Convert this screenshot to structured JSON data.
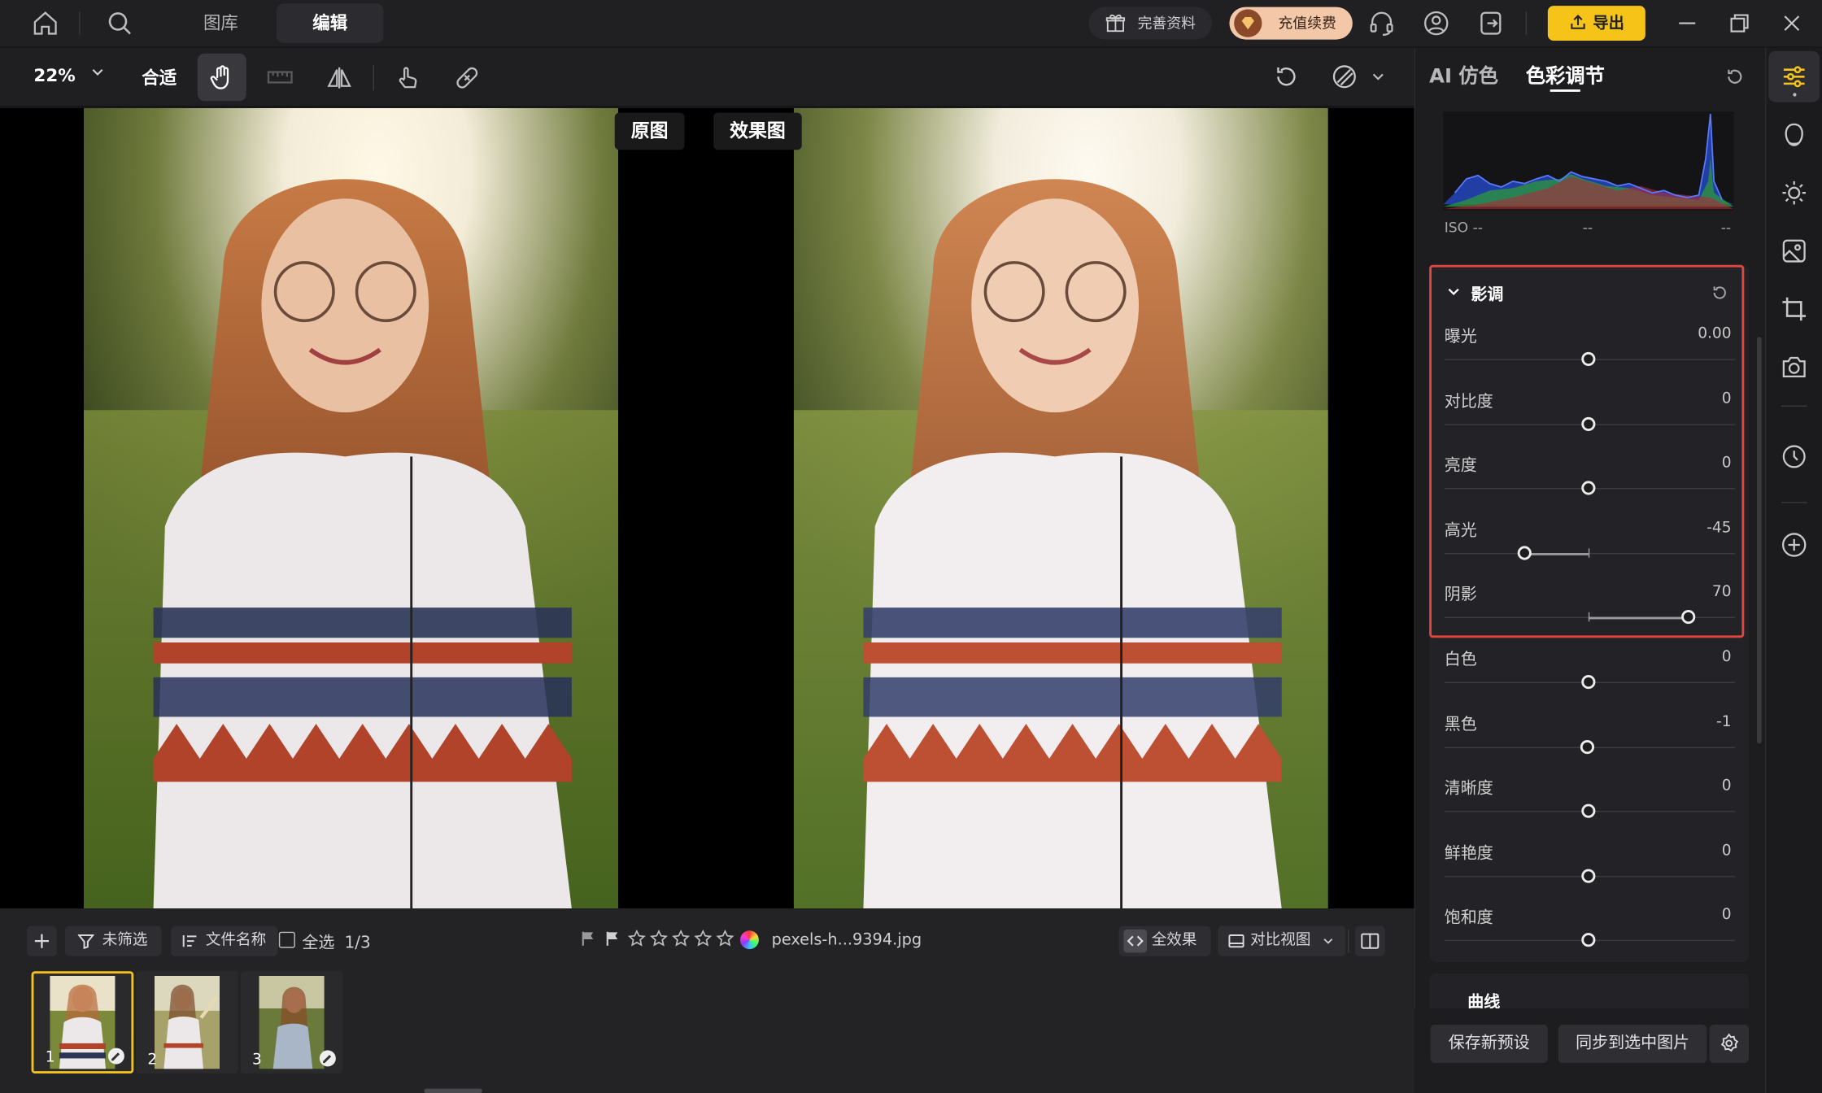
{
  "nav": {
    "tabs": [
      {
        "label": "图库"
      },
      {
        "label": "编辑"
      }
    ],
    "profile_label": "完善资料",
    "recharge_label": "充值续费",
    "export_label": "导出"
  },
  "toolbar": {
    "zoom_label": "22%",
    "fit_label": "合适"
  },
  "compare": {
    "original_label": "原图",
    "result_label": "效果图"
  },
  "filmstrip": {
    "filter_label": "未筛选",
    "sort_label": "文件名称",
    "select_all_label": "全选",
    "selection_count": "1/3",
    "filename": "pexels-h...9394.jpg",
    "all_effects_label": "全效果",
    "compare_view_label": "对比视图",
    "thumbs": [
      {
        "num": "1"
      },
      {
        "num": "2"
      },
      {
        "num": "3"
      }
    ],
    "rating_stars": 5,
    "rating_value": 0
  },
  "panel": {
    "tabs": [
      {
        "label": "AI 仿色"
      },
      {
        "label": "色彩调节"
      }
    ],
    "iso_label": "ISO --",
    "iso_mid": "--",
    "iso_right": "--",
    "section_title": "影调",
    "next_section_partial": "曲线",
    "sliders": [
      {
        "label": "曝光",
        "value": "0.00"
      },
      {
        "label": "对比度",
        "value": "0"
      },
      {
        "label": "亮度",
        "value": "0"
      },
      {
        "label": "高光",
        "value": "-45"
      },
      {
        "label": "阴影",
        "value": "70"
      },
      {
        "label": "白色",
        "value": "0"
      },
      {
        "label": "黑色",
        "value": "-1"
      },
      {
        "label": "清晰度",
        "value": "0"
      },
      {
        "label": "鲜艳度",
        "value": "0"
      },
      {
        "label": "饱和度",
        "value": "0"
      }
    ],
    "save_preset_label": "保存新预设",
    "sync_label": "同步到选中图片"
  },
  "colors": {
    "accent": "#f6c419",
    "highlight_border": "#e2463f",
    "panel_bg": "#1d1d20"
  }
}
